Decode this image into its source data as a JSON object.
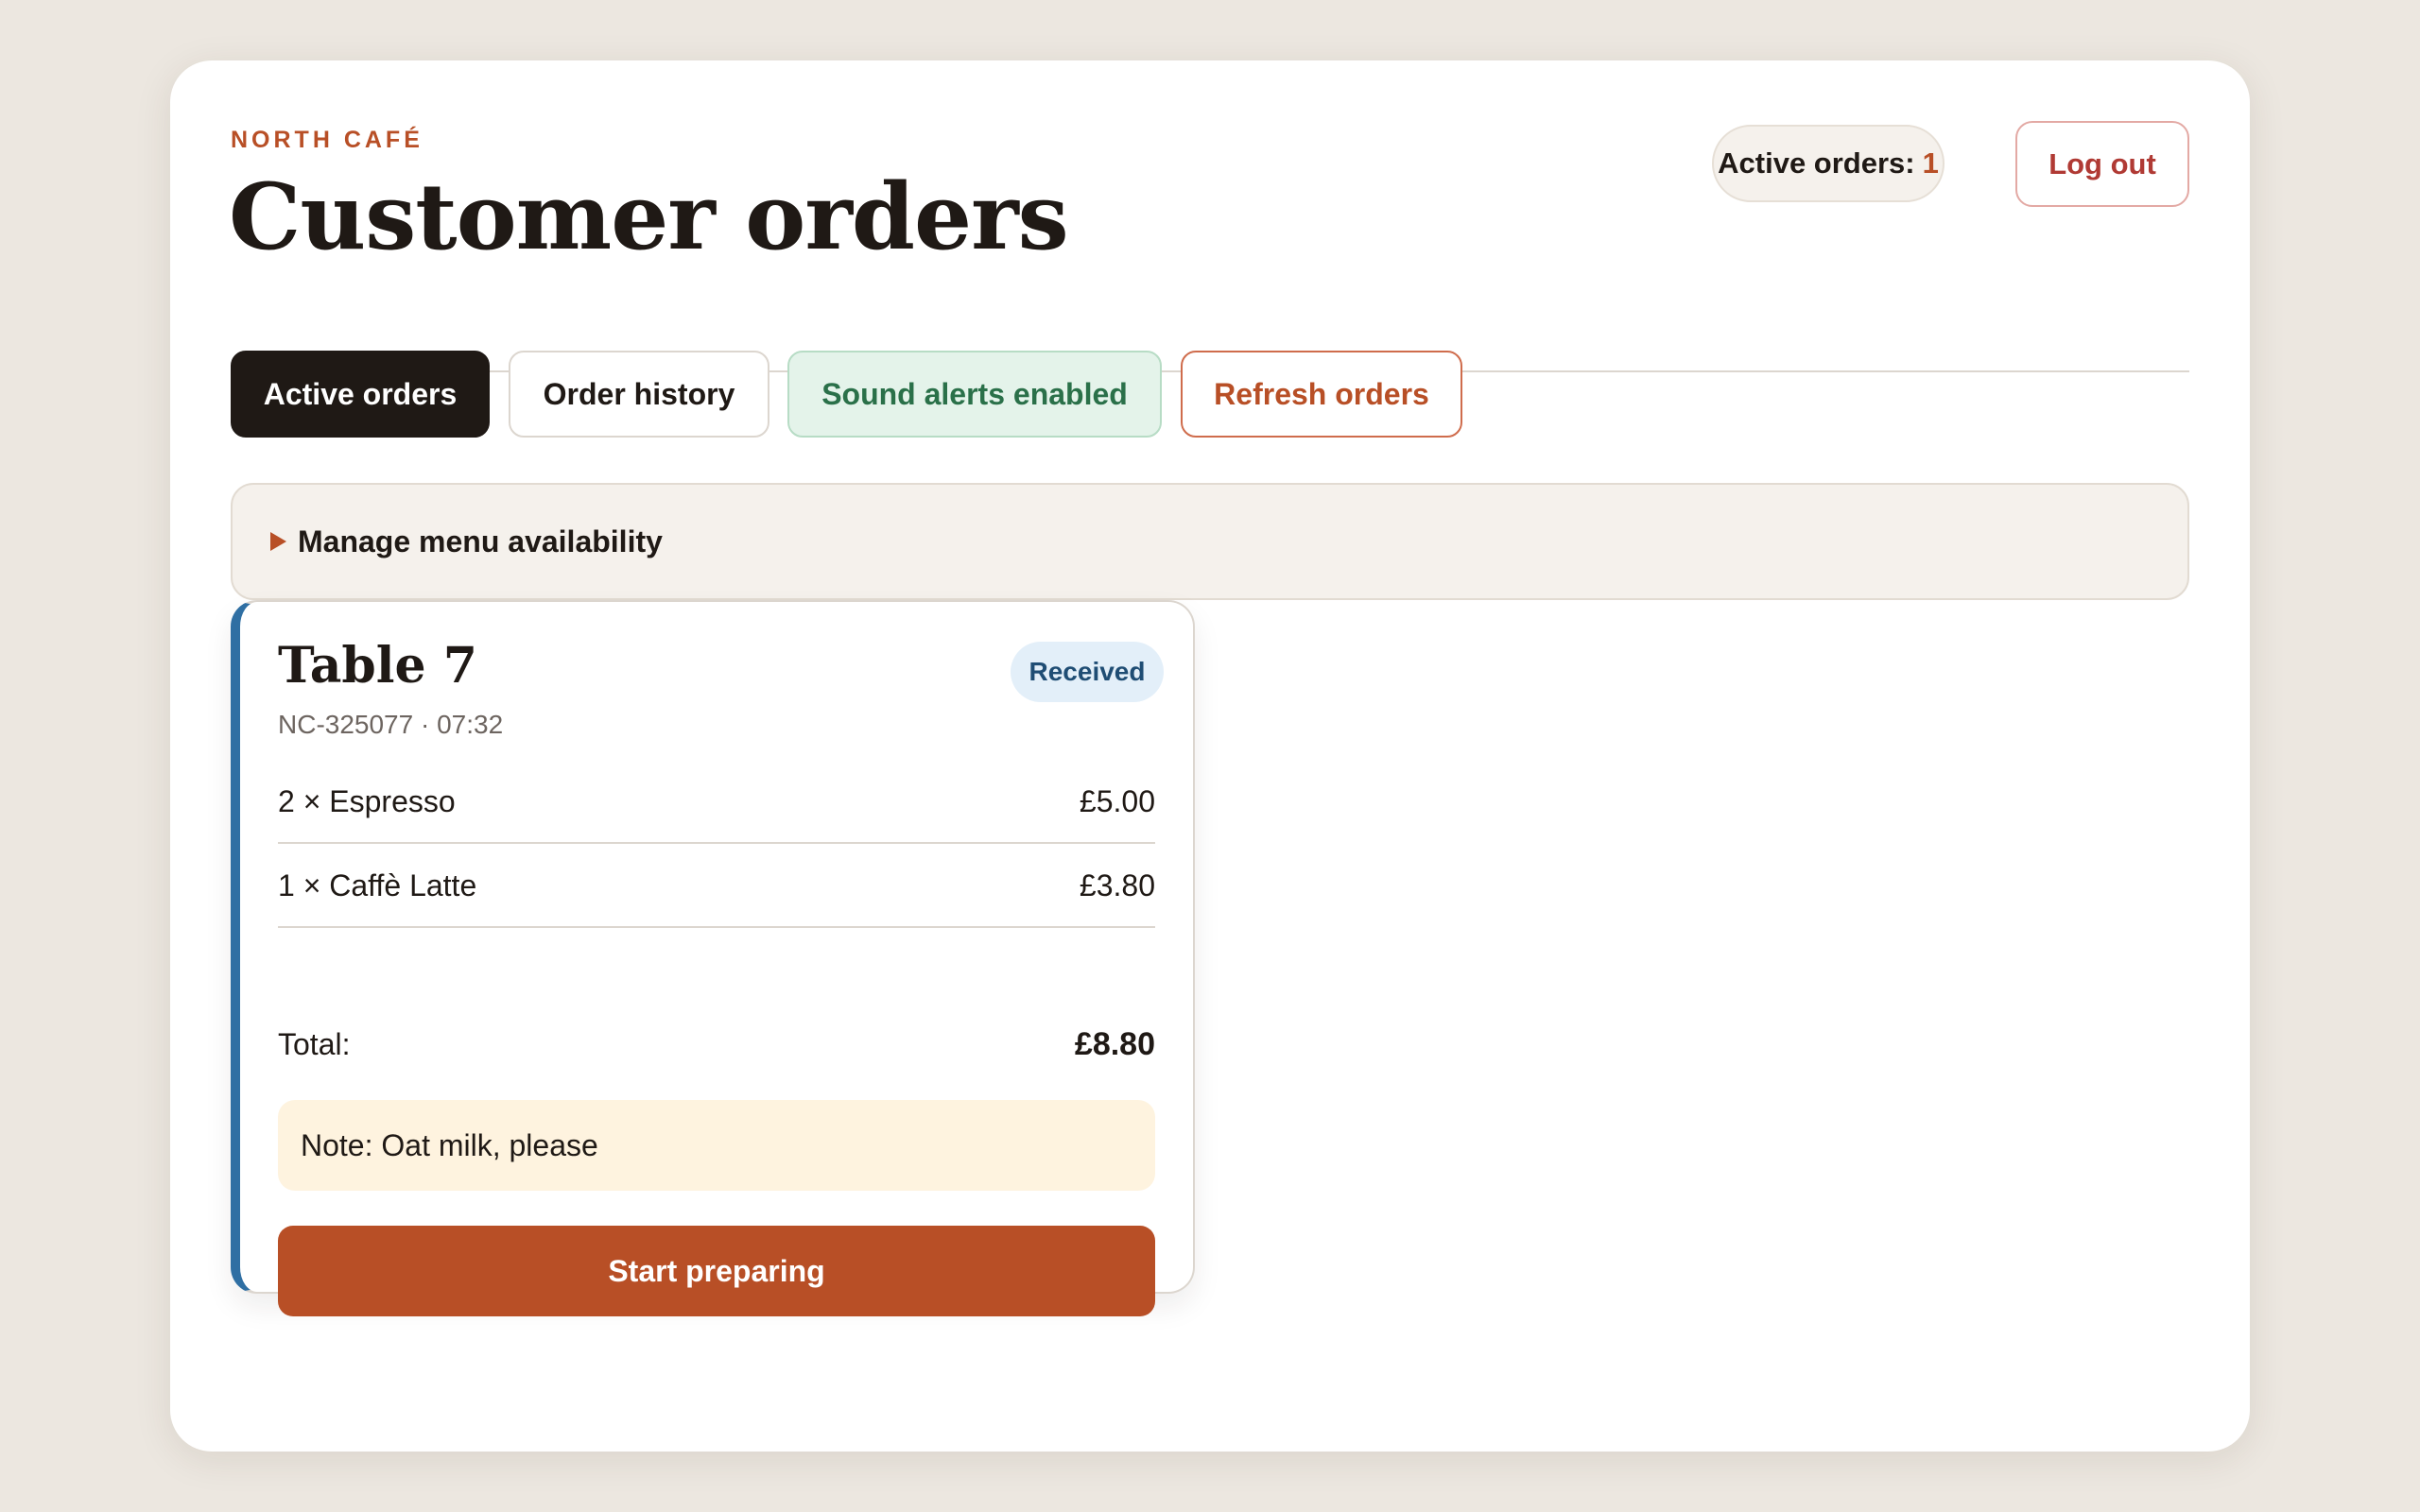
{
  "header": {
    "eyebrow": "NORTH CAFÉ",
    "title": "Customer orders",
    "active_orders_label": "Active orders:",
    "active_orders_count": "1",
    "logout_label": "Log out"
  },
  "tabs": [
    {
      "label": "Active orders",
      "selected": true
    },
    {
      "label": "Order history",
      "selected": false
    },
    {
      "label": "Sound alerts enabled",
      "selected": false
    },
    {
      "label": "Refresh orders",
      "selected": false
    }
  ],
  "menu_availability": {
    "label": "Manage menu availability",
    "icon": "caret-right-icon",
    "expanded": false
  },
  "orders": [
    {
      "title": "Table 7",
      "status": "Received",
      "meta": "NC-325077 · 07:32",
      "items": [
        {
          "label": "2 × Espresso",
          "price": "£5.00"
        },
        {
          "label": "1 × Caffè Latte",
          "price": "£3.80"
        }
      ],
      "total_label": "Total:",
      "total_value": "£8.80",
      "note": "Note: Oat milk, please",
      "action_label": "Start preparing"
    }
  ],
  "colors": {
    "accent": "#b84f26",
    "background": "#ece7e0",
    "card_stripe": "#2f6fa3",
    "sound_enabled": "#2a7049",
    "logout": "#b03a34"
  }
}
